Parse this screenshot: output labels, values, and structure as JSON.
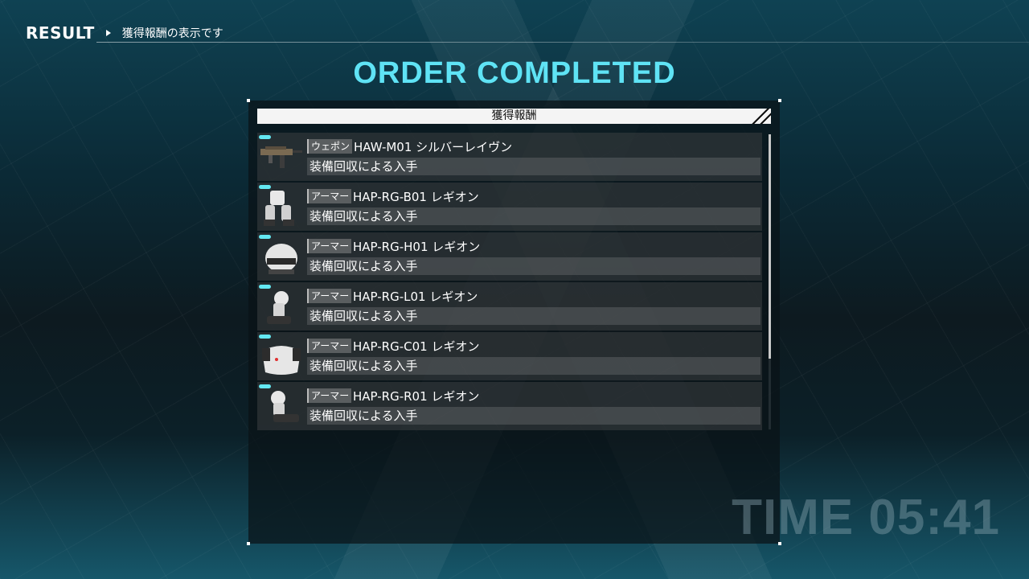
{
  "header": {
    "section": "RESULT",
    "description": "獲得報酬の表示です"
  },
  "title": "ORDER COMPLETED",
  "panel": {
    "heading": "獲得報酬"
  },
  "rewards": [
    {
      "category": "ウェポン",
      "name": "HAW-M01 シルバーレイヴン",
      "source": "装備回収による入手",
      "icon": "rifle-icon"
    },
    {
      "category": "アーマー",
      "name": "HAP-RG-B01 レギオン",
      "source": "装備回収による入手",
      "icon": "body-armor-icon"
    },
    {
      "category": "アーマー",
      "name": "HAP-RG-H01 レギオン",
      "source": "装備回収による入手",
      "icon": "helmet-icon"
    },
    {
      "category": "アーマー",
      "name": "HAP-RG-L01 レギオン",
      "source": "装備回収による入手",
      "icon": "left-arm-armor-icon"
    },
    {
      "category": "アーマー",
      "name": "HAP-RG-C01 レギオン",
      "source": "装備回収による入手",
      "icon": "chest-armor-icon"
    },
    {
      "category": "アーマー",
      "name": "HAP-RG-R01 レギオン",
      "source": "装備回収による入手",
      "icon": "right-arm-armor-icon"
    }
  ],
  "scroll": {
    "visible_fraction": 0.76
  },
  "timer": "TIME 05:41",
  "colors": {
    "accent": "#5fe3f5",
    "tab": "#63e8f2"
  }
}
